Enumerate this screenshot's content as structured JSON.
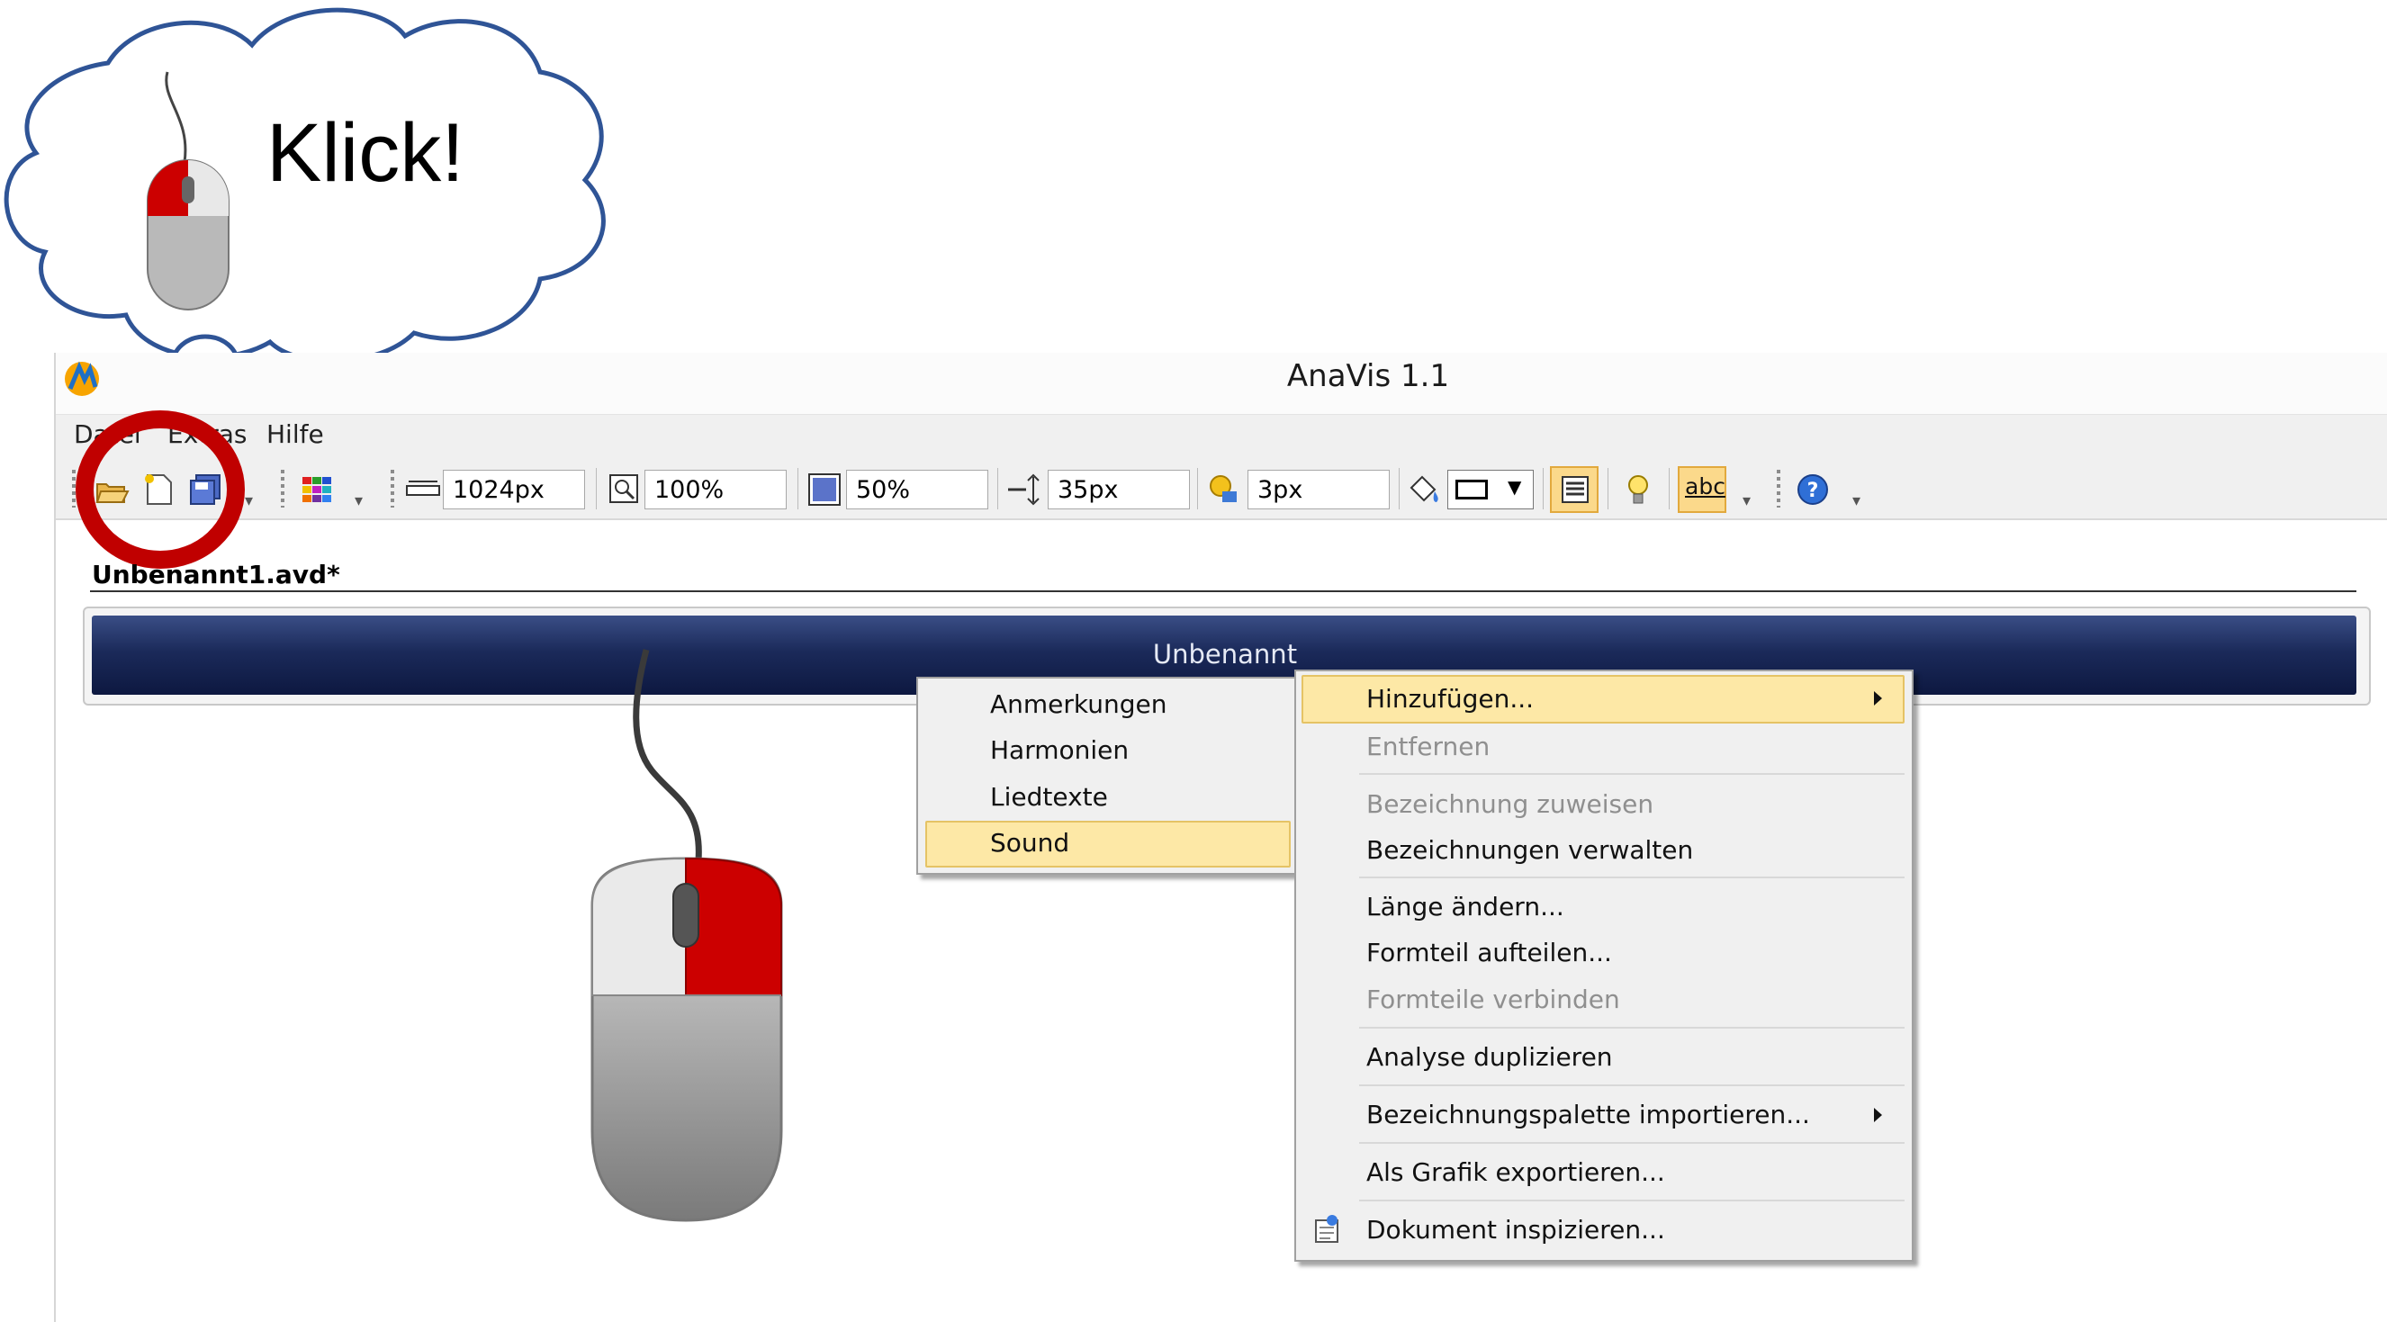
{
  "annotation": {
    "cloud_text": "Klick!"
  },
  "window": {
    "title": "AnaVis 1.1"
  },
  "menubar": {
    "items": [
      "Datei",
      "Extras",
      "Hilfe"
    ]
  },
  "toolbar": {
    "width_value": "1024px",
    "zoom_value": "100%",
    "opacity_value": "50%",
    "height_value": "35px",
    "border_value": "3px",
    "spellcheck_label": "abc",
    "colors": {
      "toggle_bg": "#fbd98b",
      "toggle_border": "#e2a93d"
    },
    "icons": [
      "open-icon",
      "new-icon",
      "save-icon",
      "palette-icon",
      "width-icon",
      "zoom-icon",
      "opacity-icon",
      "height-icon",
      "border-icon",
      "fill-icon",
      "rectangle-style-icon",
      "list-icon",
      "lightbulb-icon",
      "spellcheck-icon",
      "help-icon"
    ]
  },
  "document": {
    "tab_label": "Unbenannt1.avd*",
    "section_label": "Unbenannt",
    "section_colors": {
      "top": "#3a4e86",
      "bottom": "#0d1840"
    }
  },
  "submenu": {
    "items": [
      "Anmerkungen",
      "Harmonien",
      "Liedtexte",
      "Sound"
    ],
    "highlighted": "Sound"
  },
  "context_menu": {
    "add": "Hinzufügen...",
    "remove": "Entfernen",
    "assign_label": "Bezeichnung zuweisen",
    "manage_labels": "Bezeichnungen verwalten",
    "change_length": "Länge ändern...",
    "split_part": "Formteil aufteilen...",
    "join_parts": "Formteile verbinden",
    "duplicate": "Analyse duplizieren",
    "import_palette": "Bezeichnungspalette importieren...",
    "export_graphic": "Als Grafik exportieren...",
    "inspect_document": "Dokument inspizieren...",
    "highlight_color": "#fde8a6"
  }
}
